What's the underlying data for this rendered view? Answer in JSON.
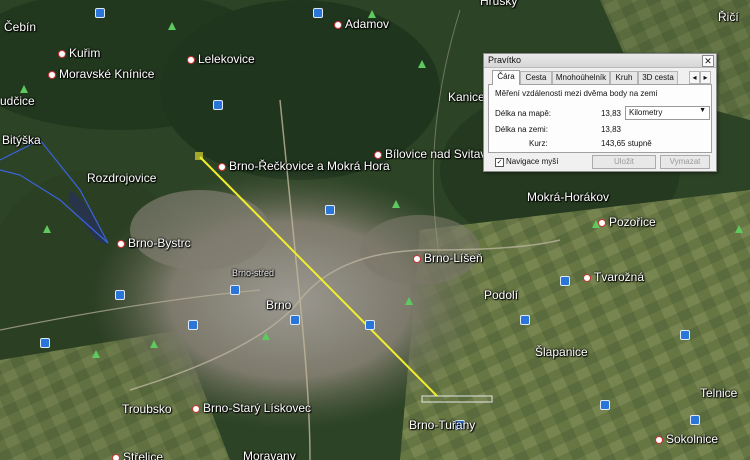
{
  "map": {
    "places": [
      {
        "id": "cebin",
        "name": "Čebín"
      },
      {
        "id": "kurim",
        "name": "Kuřim"
      },
      {
        "id": "moravske-kninice",
        "name": "Moravské Knínice"
      },
      {
        "id": "lelekovice",
        "name": "Lelekovice"
      },
      {
        "id": "adamov",
        "name": "Adamov"
      },
      {
        "id": "kanice",
        "name": "Kanice"
      },
      {
        "id": "rudcice",
        "name": "udčice"
      },
      {
        "id": "bityska",
        "name": "Bitýška"
      },
      {
        "id": "brno-reckovice",
        "name": "Brno-Řečkovice a Mokrá Hora"
      },
      {
        "id": "bilovice",
        "name": "Bílovice nad Svitavou"
      },
      {
        "id": "rozdrojovice",
        "name": "Rozdrojovice"
      },
      {
        "id": "mokra-horakov",
        "name": "Mokrá-Horákov"
      },
      {
        "id": "pozorice",
        "name": "Pozořice"
      },
      {
        "id": "brno-bystrc",
        "name": "Brno-Bystrc"
      },
      {
        "id": "brno-lisen",
        "name": "Brno-Líšeň"
      },
      {
        "id": "tvarozna",
        "name": "Tvarožná"
      },
      {
        "id": "brno-centre",
        "name": "Brno-střed"
      },
      {
        "id": "brno",
        "name": "Brno"
      },
      {
        "id": "podoli",
        "name": "Podolí"
      },
      {
        "id": "slapanice",
        "name": "Šlapanice"
      },
      {
        "id": "troubsko",
        "name": "Troubsko"
      },
      {
        "id": "brno-stary-liskovec",
        "name": "Brno-Starý Lískovec"
      },
      {
        "id": "brno-turany",
        "name": "Brno-Tuřany"
      },
      {
        "id": "strelice",
        "name": "Střelice"
      },
      {
        "id": "moravany",
        "name": "Moravany"
      },
      {
        "id": "telnice",
        "name": "Telnice"
      },
      {
        "id": "sokolnice",
        "name": "Sokolnice"
      },
      {
        "id": "hruby",
        "name": "Hrušky"
      },
      {
        "id": "rici",
        "name": "Řičí"
      }
    ],
    "route_color": "#f1ee2f",
    "boundary_color": "#3a64e0"
  },
  "ruler": {
    "title": "Pravítko",
    "close_label": "✕",
    "tabs": [
      {
        "label": "Čára",
        "active": true
      },
      {
        "label": "Cesta",
        "active": false
      },
      {
        "label": "Mnohoúhelník",
        "active": false
      },
      {
        "label": "Kruh",
        "active": false
      },
      {
        "label": "3D cesta",
        "active": false
      }
    ],
    "tab_prev": "◂",
    "tab_next": "▸",
    "description": "Měření vzdálenosti mezi dvěma body na zemi",
    "map_length_label": "Délka na mapě:",
    "map_length_value": "13,83",
    "unit_selected": "Kilometry",
    "ground_length_label": "Délka na zemi:",
    "ground_length_value": "13,83",
    "heading_label": "Kurz:",
    "heading_value": "143,65 stupně",
    "nav_checkbox_label": "Navigace myší",
    "nav_checkbox_checked": true,
    "save_label": "Uložit",
    "clear_label": "Vymazat"
  }
}
